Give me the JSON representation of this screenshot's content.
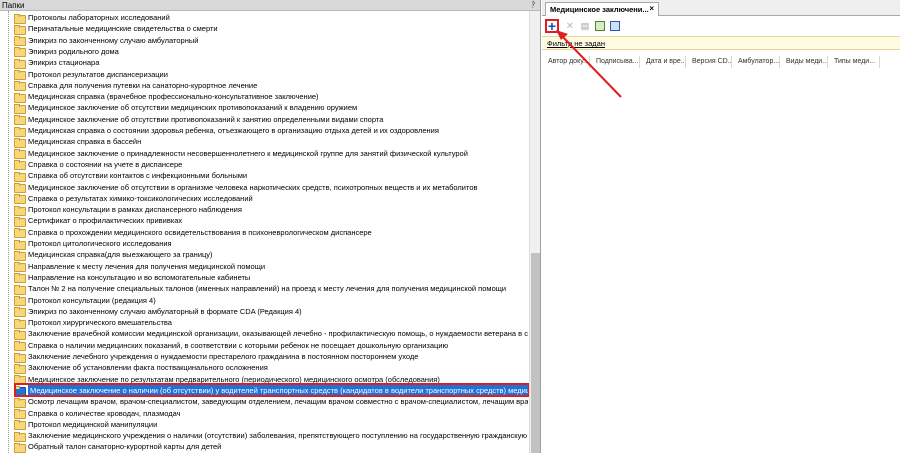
{
  "left_panel": {
    "title": "Папки",
    "pin_icon": "pin-icon",
    "items": [
      "Протоколы лабораторных исследований",
      "Перинатальные медицинские свидетельства о смерти",
      "Эпикриз по законченному случаю амбулаторный",
      "Эпикриз родильного дома",
      "Эпикриз стационара",
      "Протокол результатов диспансеризации",
      "Справка для получения путевки на санаторно-курортное лечение",
      "Медицинская справка (врачебное профессионально-консультативное заключение)",
      "Медицинское заключение об отсутствии медицинских противопоказаний к владению оружием",
      "Медицинское заключение об отсутствии противопоказаний к занятию определенными видами спорта",
      "Медицинская справка о состоянии здоровья ребенка, отъезжающего в организацию отдыха детей и их оздоровления",
      "Медицинская справка в бассейн",
      "Медицинское заключение о принадлежности несовершеннолетнего к медицинской группе для занятий физической культурой",
      "Справка о состоянии на учете в диспансере",
      "Справка об отсутствии контактов с инфекционными больными",
      "Медицинское заключение об отсутствии в организме человека наркотических средств, психотропных веществ и их метаболитов",
      "Справка о результатах химико-токсикологических исследований",
      "Протокол консультации в рамках диспансерного наблюдения",
      "Сертификат о профилактических прививках",
      "Справка о прохождении медицинского освидетельствования в психоневрологическом диспансере",
      "Протокол цитологического исследования",
      "Медицинская справка(для выезжающего за границу)",
      "Направление к месту лечения для получения медицинской помощи",
      "Направление на консультацию и во вспомогательные кабинеты",
      "Талон № 2 на получение специальных талонов (именных направлений) на проезд к месту лечения для получения медицинской помощи",
      "Протокол консультации (редакция 4)",
      "Эпикриз по законченному случаю амбулаторный в формате CDA (Редакция 4)",
      "Протокол хирургического вмешательства",
      "Заключение врачебной комиссии медицинской организации, оказывающей лечебно - профилактическую помощь, о нуждаемости ветерана в с",
      "Справка о наличии медицинских показаний, в соответствии с которыми ребенок не посещает дошкольную организацию",
      "Заключение лечебного учреждения о нуждаемости престарелого гражданина в постоянном постороннем уходе",
      "Заключение об установлении факта поствакцинального осложнения",
      "Медицинское заключение по результатам предварительного (периодического) медицинского осмотра (обследования)",
      "Медицинское заключение о наличии (об отсутствии) у водителей транспортных средств (кандидатов в водители транспортных средств) медици",
      "Осмотр лечащим врачом, врачом-специалистом, заведующим отделением, лечащим врачом совместно с врачом-специалистом, лечащим вра",
      "Справка о количестве кроводач, плазмодач",
      "Протокол медицинской манипуляции",
      "Заключение медицинского учреждения о наличии (отсутствии) заболевания, препятствующего поступлению на государственную гражданскую",
      "Обратный талон санаторно-курортной карты для детей"
    ],
    "selected_index": 33
  },
  "right_panel": {
    "tab_label": "Медицинское заключени...",
    "tab_close": "×",
    "toolbar": {
      "add_icon": "plus-icon",
      "add_label": "+",
      "delete_icon": "delete-icon",
      "open_icon": "open-icon",
      "export_icon": "export-icon",
      "refresh_icon": "refresh-icon"
    },
    "filter_label": "Фильтр не задан",
    "columns": [
      "Автор доку...",
      "Подписыва...",
      "Дата и вре...",
      "Версия CD...",
      "Амбулатор...",
      "Виды меди...",
      "Типы меди..."
    ]
  },
  "colors": {
    "selection": "#1d73d8",
    "highlight_red": "#e01e1e",
    "folder": "#f7d77a"
  }
}
